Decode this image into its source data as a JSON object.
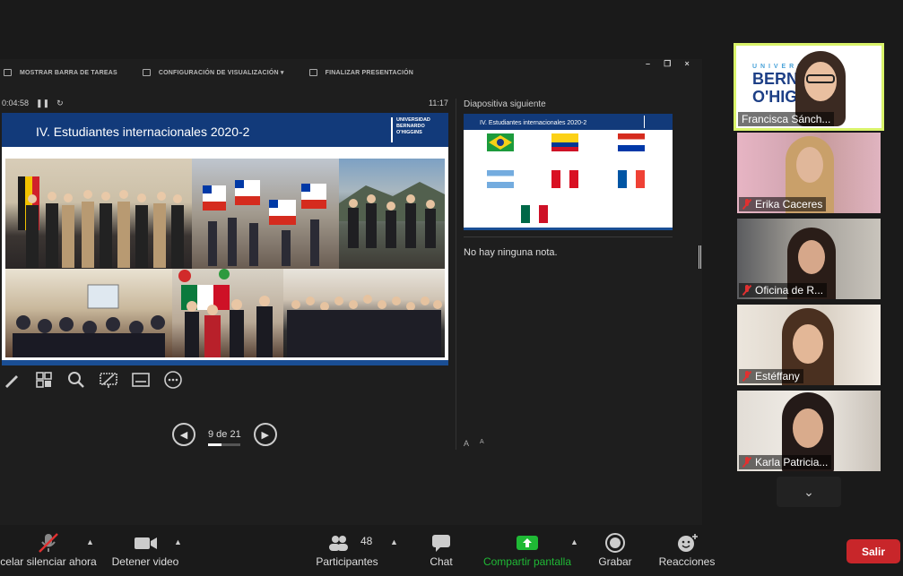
{
  "toolbar": {
    "show_taskbar": "MOSTRAR BARRA DE TAREAS",
    "display_settings": "CONFIGURACIÓN DE VISUALIZACIÓN ▾",
    "end_presentation": "FINALIZAR PRESENTACIÓN",
    "minimize": "–",
    "restore": "❐",
    "close": "×"
  },
  "presenter": {
    "elapsed": "0:04:58",
    "clock": "11:17",
    "slide_title": "IV. Estudiantes internacionales 2020-2",
    "logo_text": [
      "UNIVERSIDAD",
      "BERNARDO",
      "O'HIGGINS"
    ],
    "page_indicator": "9 de 21",
    "progress": 0.43,
    "next_label": "Diapositiva siguiente",
    "next_title": "IV. Estudiantes internacionales 2020-2",
    "notes": "No hay ninguna nota.",
    "font_up": "A",
    "font_down": "A"
  },
  "participants": [
    {
      "name": "Francisca Sánch...",
      "muted": false,
      "active": true
    },
    {
      "name": "Erika Caceres",
      "muted": true
    },
    {
      "name": "Oficina de R...",
      "muted": true
    },
    {
      "name": "Estéffany",
      "muted": true
    },
    {
      "name": "Karla Patricia...",
      "muted": true
    }
  ],
  "active_logo": [
    "U N I V E R S I D A D",
    "BERNARDO",
    "O'HIGGINS"
  ],
  "bottom_bar": {
    "unmute": "celar silenciar ahora",
    "video": "Detener video",
    "participants": "Participantes",
    "participants_count": "48",
    "chat": "Chat",
    "share": "Compartir pantalla",
    "record": "Grabar",
    "reactions": "Reacciones",
    "leave": "Salir"
  },
  "colors": {
    "accent_green": "#1fb935",
    "leave_red": "#c8262a",
    "slide_blue": "#123a7a",
    "active_border": "#d9f36a"
  }
}
